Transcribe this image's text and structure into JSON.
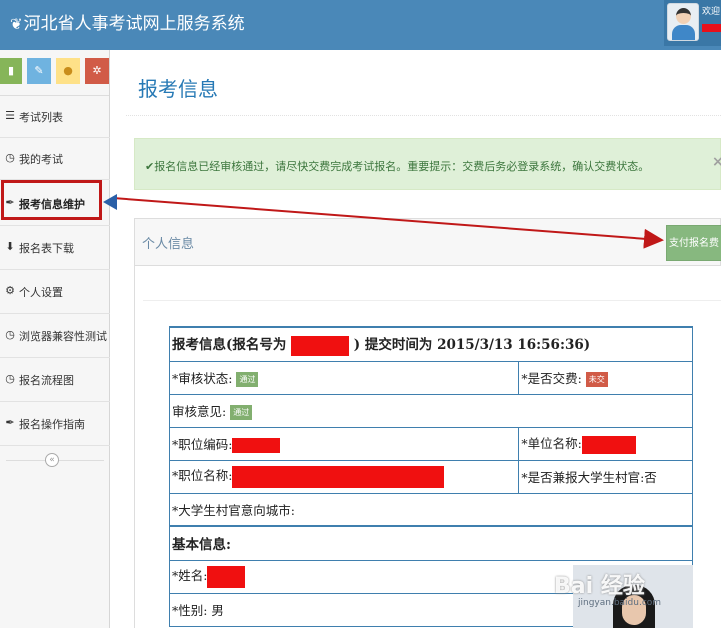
{
  "header": {
    "brand": "河北省人事考试网上服务系统",
    "welcome": "欢迎"
  },
  "sidebar": {
    "items": [
      {
        "label": "考试列表",
        "icon": "list-icon"
      },
      {
        "label": "我的考试",
        "icon": "dashboard-icon"
      },
      {
        "label": "报考信息维护",
        "icon": "wrench-icon",
        "active": true
      },
      {
        "label": "报名表下载",
        "icon": "download-icon"
      },
      {
        "label": "个人设置",
        "icon": "gear-icon"
      },
      {
        "label": "浏览器兼容性测试",
        "icon": "dashboard-icon"
      },
      {
        "label": "报名流程图",
        "icon": "dashboard-icon"
      },
      {
        "label": "报名操作指南",
        "icon": "wrench-icon"
      }
    ]
  },
  "main": {
    "title": "报考信息",
    "alert": "✔报名信息已经审核通过，请尽快交费完成考试报名。重要提示：交费后务必登录系统，确认交费状态。",
    "alert_close": "×",
    "panel_title": "个人信息",
    "pay_button": "支付报名费"
  },
  "table": {
    "head_prefix": "报考信息(报名号为",
    "head_suffix": ")  提交时间为 2015/3/13 16:56:36)",
    "audit_status_label": "*审核状态:",
    "audit_status_value": "通过",
    "paid_label": "*是否交费:",
    "paid_value": "未交",
    "audit_opinion_label": "审核意见:",
    "audit_opinion_value": "通过",
    "position_code_label": "*职位编码:",
    "unit_name_label": "*单位名称:",
    "position_name_label": "*职位名称:",
    "college_official_label": "*是否兼报大学生村官:否",
    "city_label": "*大学生村官意向城市:",
    "basic_info": "基本信息:",
    "name_label": "*姓名:",
    "gender_label": "*性别: 男"
  },
  "watermark": {
    "text": "Bai 经验",
    "sub": "jingyan.baidu.com"
  }
}
